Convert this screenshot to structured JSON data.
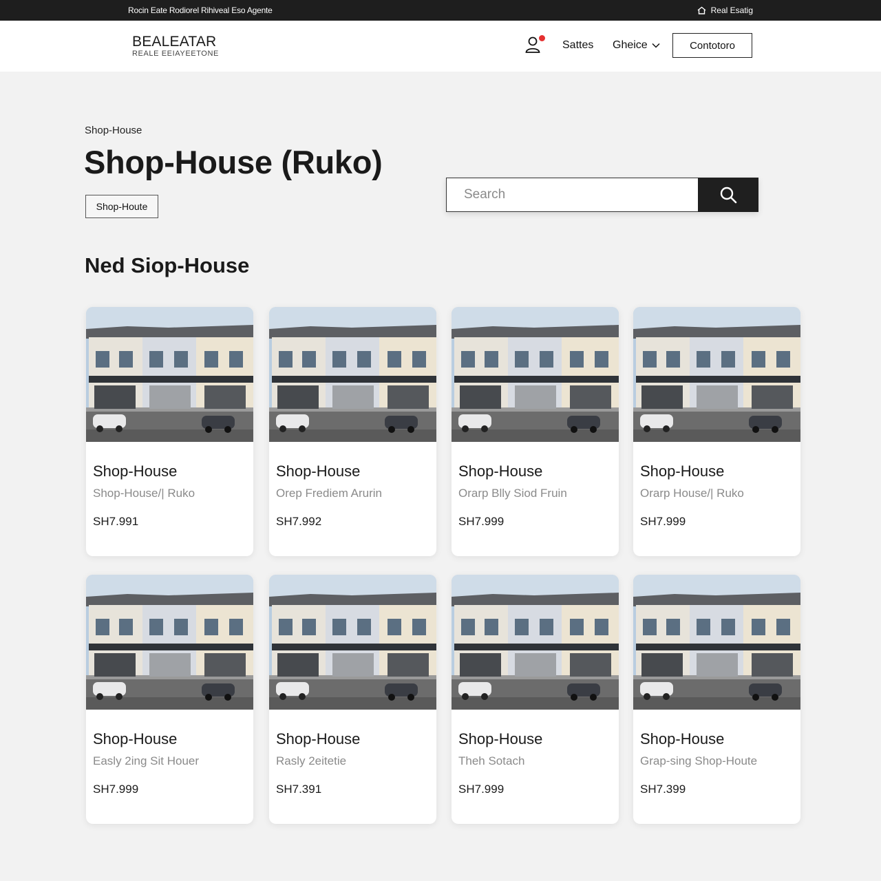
{
  "topbar": {
    "left_text": "Rocin Eate Rodiorel Rihiveal Eso Agente",
    "right_text": "Real Esatig"
  },
  "header": {
    "logo_main": "BEALEATAR",
    "logo_sub": "REALE EEIAYEETONE",
    "nav_sales": "Sattes",
    "nav_choice": "Gheice",
    "contact_label": "Contotoro"
  },
  "hero": {
    "breadcrumb": "Shop-House",
    "title": "Shop-House (Ruko)",
    "tag": "Shop-Houte"
  },
  "search": {
    "placeholder": "Search"
  },
  "section": {
    "title": "Ned Siop-House"
  },
  "listings": [
    {
      "title": "Shop-House",
      "subtitle": "Shop-House/| Ruko",
      "price": "SH7.991"
    },
    {
      "title": "Shop-House",
      "subtitle": "Orep Frediem Arurin",
      "price": "SH7.992"
    },
    {
      "title": "Shop-House",
      "subtitle": "Orarp Blly Siod Fruin",
      "price": "SH7.999"
    },
    {
      "title": "Shop-House",
      "subtitle": "Orarp House/| Ruko",
      "price": "SH7.999"
    },
    {
      "title": "Shop-House",
      "subtitle": "Easly 2ing Sit Houer",
      "price": "SH7.999"
    },
    {
      "title": "Shop-House",
      "subtitle": "Rasly 2eitetie",
      "price": "SH7.391"
    },
    {
      "title": "Shop-House",
      "subtitle": "Theh Sotach",
      "price": "SH7.999"
    },
    {
      "title": "Shop-House",
      "subtitle": "Grap-sing Shop-Houte",
      "price": "SH7.399"
    }
  ],
  "colors": {
    "topbar_bg": "#1e1e1e",
    "page_bg": "#f2f2f2",
    "notification_dot": "#e53030",
    "search_button": "#1f1f1f"
  }
}
